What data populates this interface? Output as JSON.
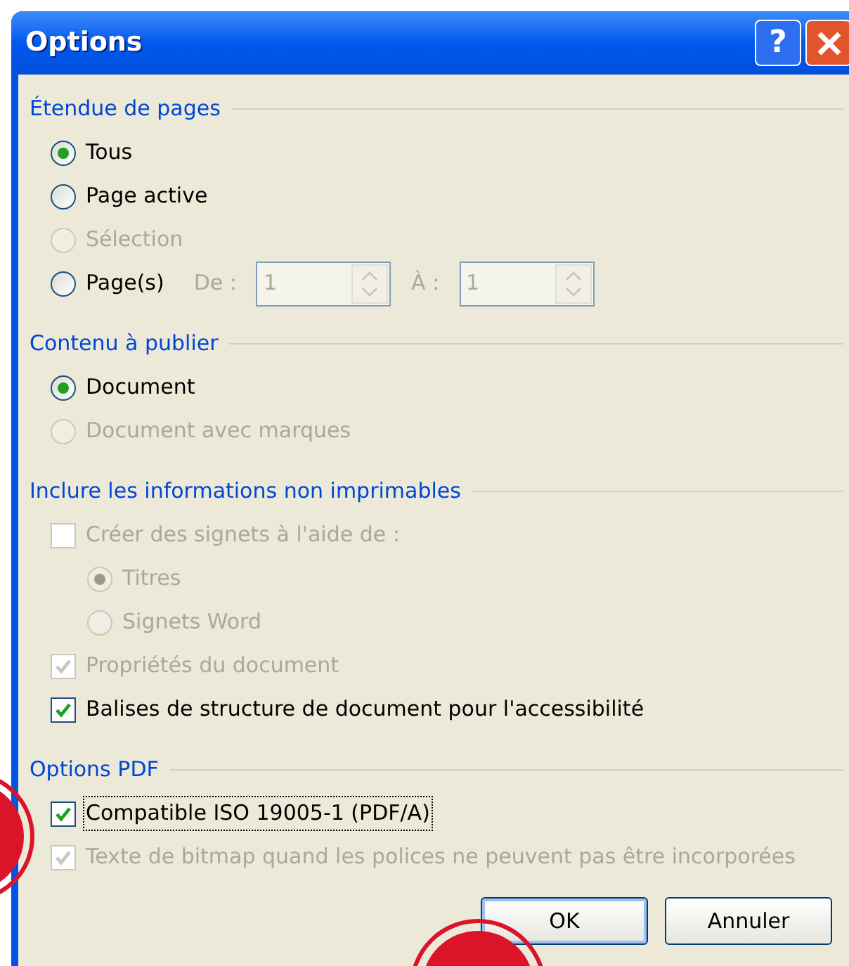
{
  "window": {
    "title": "Options"
  },
  "title_buttons": [
    {
      "kind": "help",
      "label": "?"
    },
    {
      "kind": "close"
    }
  ],
  "sections": [
    {
      "title": "Étendue de pages",
      "items": [
        {
          "kind": "radio",
          "label": "Tous",
          "selected": true,
          "disabled": false
        },
        {
          "kind": "radio",
          "label": "Page active",
          "selected": false,
          "disabled": false
        },
        {
          "kind": "radio",
          "label": "Sélection",
          "selected": false,
          "disabled": true
        },
        {
          "kind": "radio_range",
          "label": "Page(s)",
          "selected": false,
          "disabled": false,
          "range": {
            "from_label": "De :",
            "from_value": "1",
            "to_label": "À :",
            "to_value": "1",
            "disabled": true
          }
        }
      ]
    },
    {
      "title": "Contenu à publier",
      "items": [
        {
          "kind": "radio",
          "label": "Document",
          "selected": true,
          "disabled": false
        },
        {
          "kind": "radio",
          "label": "Document avec marques",
          "selected": false,
          "disabled": true
        }
      ]
    },
    {
      "title": "Inclure les informations non imprimables",
      "items": [
        {
          "kind": "checkbox",
          "label": "Créer des signets à l'aide de :",
          "checked": false,
          "disabled": true,
          "children": [
            {
              "kind": "radio",
              "label": "Titres",
              "selected": true,
              "disabled": true
            },
            {
              "kind": "radio",
              "label": "Signets Word",
              "selected": false,
              "disabled": true
            }
          ]
        },
        {
          "kind": "checkbox",
          "label": "Propriétés du document",
          "checked": true,
          "disabled": true
        },
        {
          "kind": "checkbox",
          "label": "Balises de structure de document pour l'accessibilité",
          "checked": true,
          "disabled": false
        }
      ]
    },
    {
      "title": "Options PDF",
      "items": [
        {
          "kind": "checkbox",
          "label": "Compatible ISO 19005-1 (PDF/A)",
          "checked": true,
          "disabled": false,
          "focused": true
        },
        {
          "kind": "checkbox",
          "label": "Texte de bitmap quand les polices ne peuvent pas être incorporées",
          "checked": true,
          "disabled": true
        }
      ]
    }
  ],
  "buttons": [
    {
      "label": "OK",
      "default": true
    },
    {
      "label": "Annuler",
      "default": false
    }
  ]
}
